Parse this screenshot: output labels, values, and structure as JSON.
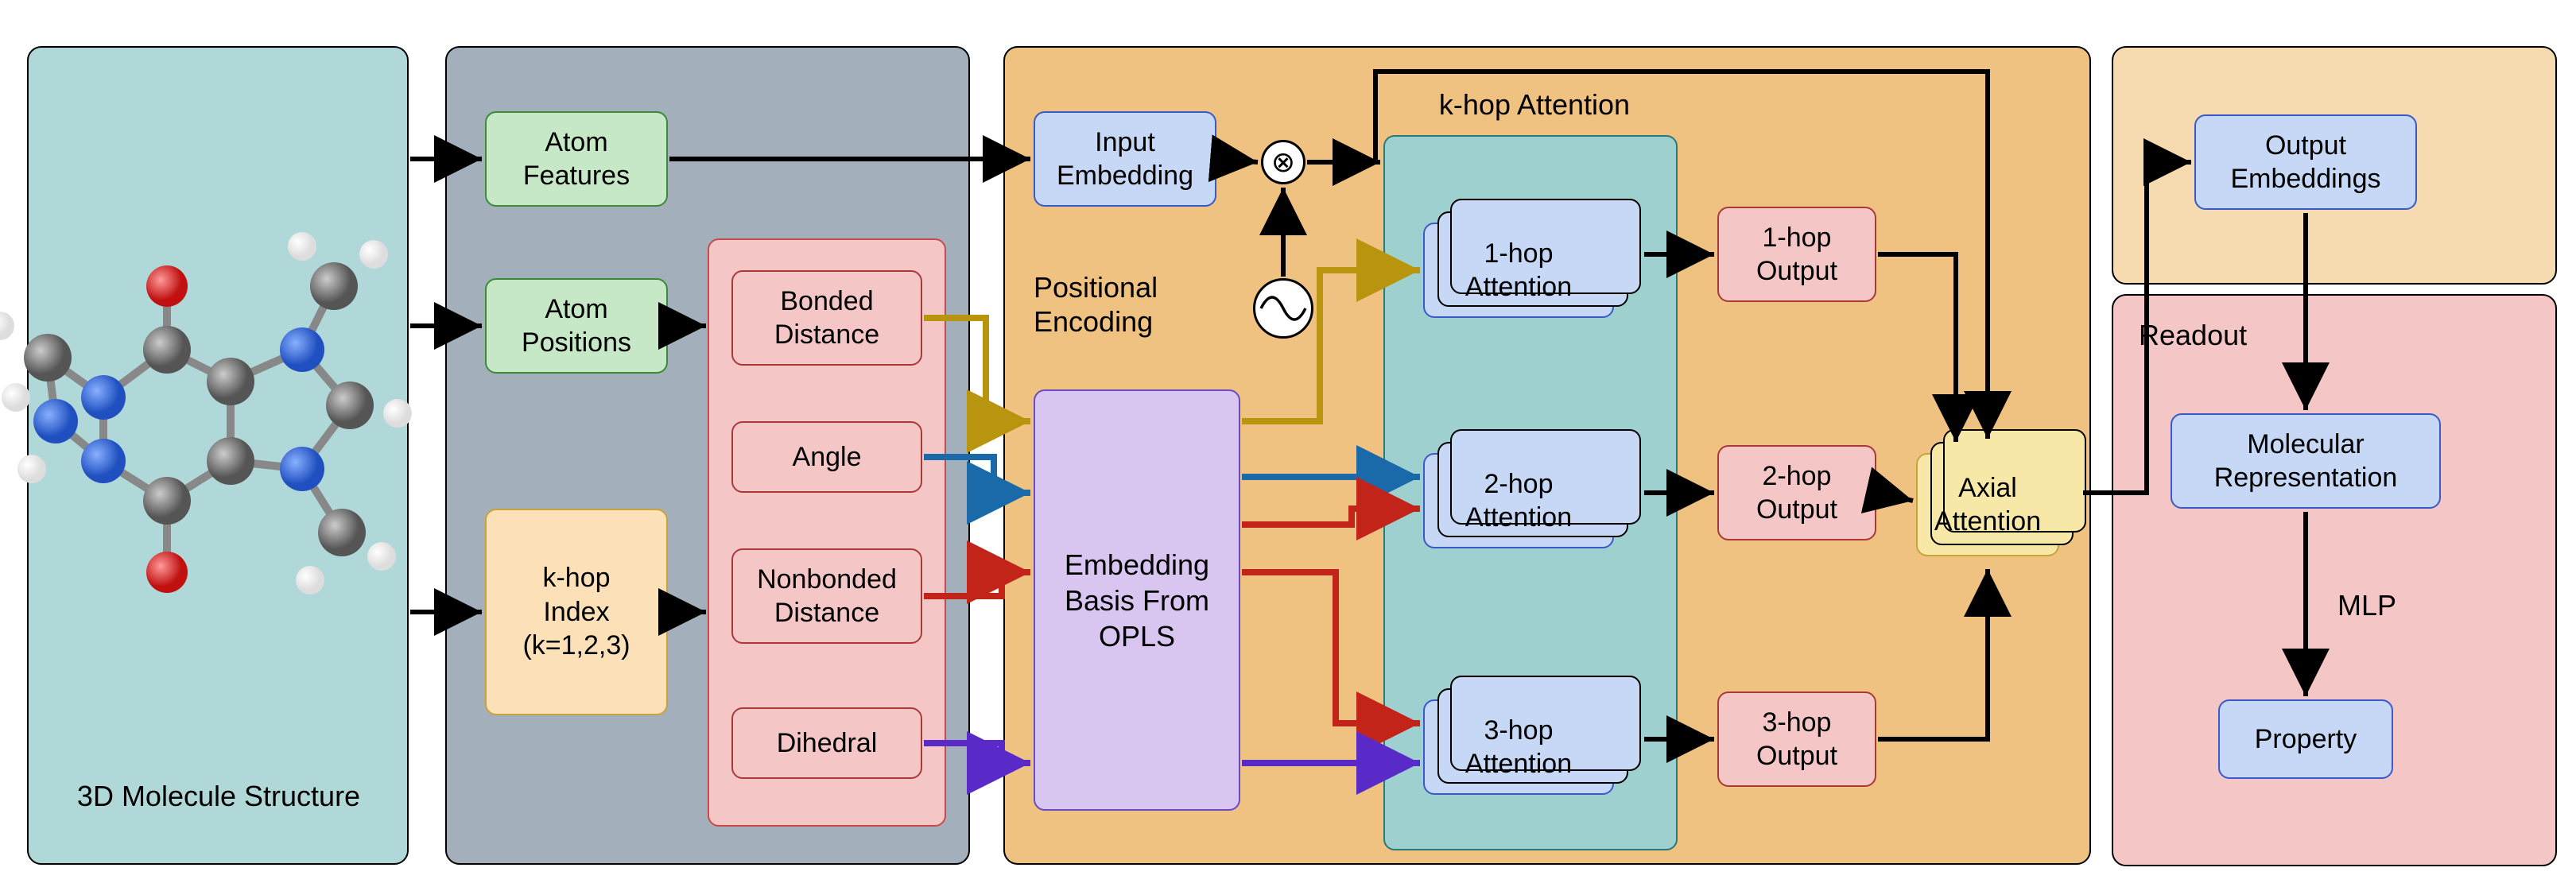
{
  "panels": {
    "molecule_title": "3D Molecule Structure",
    "readout_title": "Readout",
    "khop_title": "k-hop Attention",
    "posenc_title": "Positional\nEncoding",
    "mlp_label": "MLP"
  },
  "input_boxes": {
    "atom_features": "Atom\nFeatures",
    "atom_positions": "Atom\nPositions",
    "khop_index": "k-hop\nIndex\n(k=1,2,3)"
  },
  "geometry_boxes": {
    "bonded_distance": "Bonded\nDistance",
    "angle": "Angle",
    "nonbonded_distance": "Nonbonded\nDistance",
    "dihedral": "Dihedral"
  },
  "center_boxes": {
    "input_embedding": "Input\nEmbedding",
    "embedding_basis": "Embedding\nBasis From\nOPLS"
  },
  "attention_boxes": {
    "hop1": "1-hop\nAttention",
    "hop2": "2-hop\nAttention",
    "hop3": "3-hop\nAttention"
  },
  "output_boxes": {
    "out1": "1-hop\nOutput",
    "out2": "2-hop\nOutput",
    "out3": "3-hop\nOutput",
    "axial": "Axial\nAttention"
  },
  "readout_boxes": {
    "output_embeddings": "Output\nEmbeddings",
    "molecular_rep": "Molecular\nRepresentation",
    "property": "Property"
  },
  "colors": {
    "panel_teal": "#b0d8d8",
    "panel_gray": "#a3b0bb",
    "panel_orange": "#f0c282",
    "panel_orange_light": "#f7dbb0",
    "panel_pink": "#f5c6c6",
    "box_green": "#c6e8c6",
    "box_green_border": "#3a8a3a",
    "box_peach": "#fce0b8",
    "box_peach_border": "#c9a23a",
    "box_pink": "#f5c6c6",
    "box_pink_group_border": "#c94a4a",
    "box_pink_border": "#aa3a3a",
    "box_blue": "#c6d8f5",
    "box_blue_border": "#3a5ac9",
    "box_purple": "#d8c6f0",
    "box_purple_border": "#6a4ac9",
    "box_teal": "#9fd0d0",
    "box_teal_border": "#2a7a7a",
    "box_yellow": "#f7e8a8",
    "box_yellow_border": "#c9a23a",
    "arrow_yellow": "#b8940f",
    "arrow_blue": "#1a6aaa",
    "arrow_red": "#c2241a",
    "arrow_purple": "#5a2ac9",
    "arrow_black": "#000000"
  }
}
